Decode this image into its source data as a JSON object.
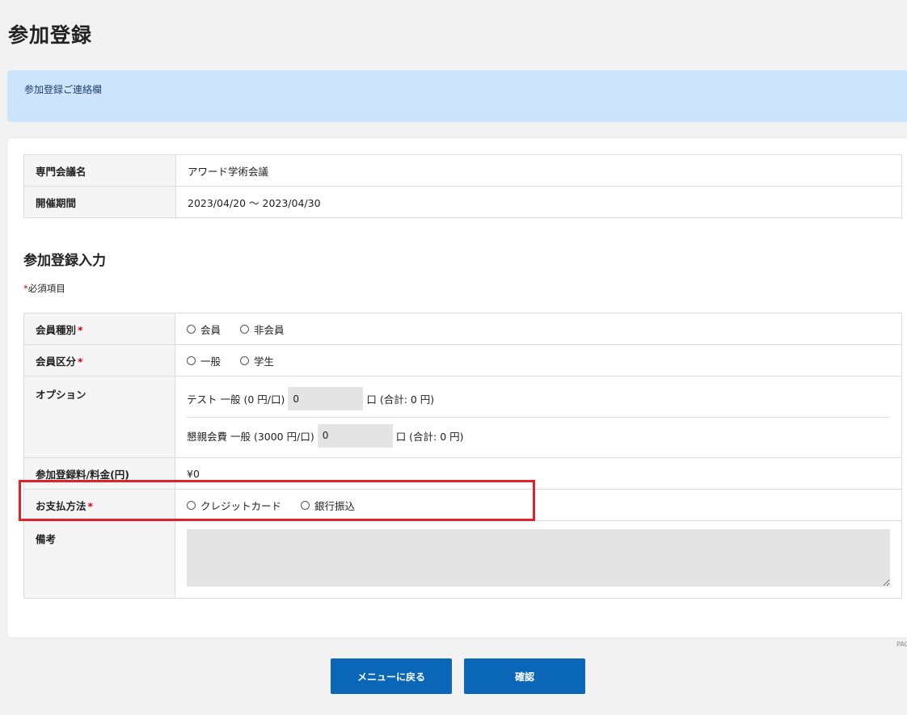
{
  "page": {
    "title": "参加登録"
  },
  "notice": {
    "text": "参加登録ご連絡欄"
  },
  "info": {
    "conference_label": "専門会議名",
    "conference_value": "アワード学術会議",
    "period_label": "開催期間",
    "period_value": "2023/04/20 ～ 2023/04/30"
  },
  "form": {
    "section_title": "参加登録入力",
    "required_star": "*",
    "required_note": "必須項目",
    "member_type": {
      "label": "会員種別",
      "options": [
        "会員",
        "非会員"
      ]
    },
    "member_class": {
      "label": "会員区分",
      "options": [
        "一般",
        "学生"
      ]
    },
    "options": {
      "label": "オプション",
      "items": [
        {
          "name": "テスト 一般 (0 円/口)",
          "qty": "0",
          "total": "口 (合計: 0 円)"
        },
        {
          "name": "懇親会費 一般 (3000 円/口)",
          "qty": "0",
          "total": "口 (合計: 0 円)"
        }
      ]
    },
    "fee": {
      "label": "参加登録料/料金(円)",
      "value": "¥0"
    },
    "payment": {
      "label": "お支払方法",
      "options": [
        "クレジットカード",
        "銀行振込"
      ]
    },
    "memo": {
      "label": "備考",
      "value": ""
    }
  },
  "buttons": {
    "back": "メニューに戻る",
    "confirm": "確認"
  },
  "pagetop": {
    "text": "PAG"
  },
  "colors": {
    "accent": "#0a67b8",
    "notice_bg": "#cce5fb",
    "highlight": "#e0202b",
    "required": "#d0021b"
  }
}
